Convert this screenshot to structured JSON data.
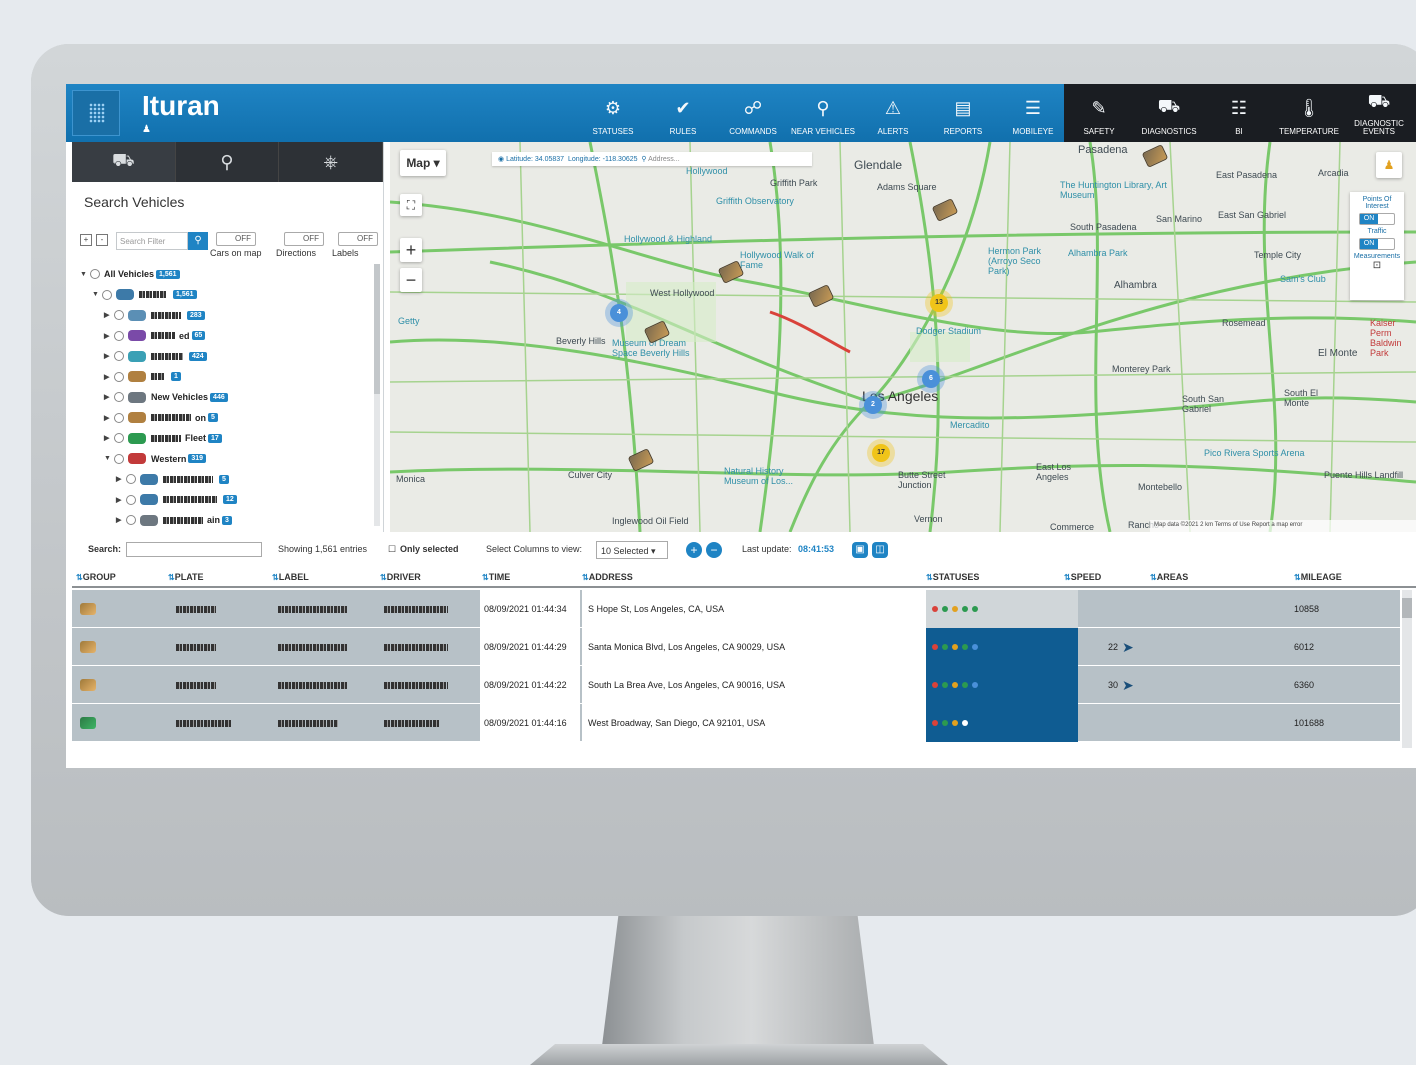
{
  "app": {
    "brand": "Ituran"
  },
  "nav": {
    "items": [
      {
        "label": "STATUSES",
        "icon": "statuses-icon"
      },
      {
        "label": "RULES",
        "icon": "rules-icon"
      },
      {
        "label": "COMMANDS",
        "icon": "commands-icon"
      },
      {
        "label": "NEAR VEHICLES",
        "icon": "near-vehicles-icon"
      },
      {
        "label": "ALERTS",
        "icon": "alerts-icon"
      },
      {
        "label": "REPORTS",
        "icon": "reports-icon"
      },
      {
        "label": "MOBILEYE",
        "icon": "mobileye-icon"
      }
    ],
    "right_items": [
      {
        "label": "SAFETY",
        "icon": "safety-icon"
      },
      {
        "label": "DIAGNOSTICS",
        "icon": "diagnostics-icon"
      },
      {
        "label": "BI",
        "icon": "bi-icon"
      },
      {
        "label": "TEMPERATURE",
        "icon": "temperature-icon"
      },
      {
        "label": "DIAGNOSTIC EVENTS",
        "icon": "diagnostic-events-icon"
      }
    ]
  },
  "left_panel": {
    "title": "Search Vehicles",
    "filter_placeholder": "Search Filter",
    "toggles": [
      {
        "state": "OFF",
        "label": "Cars on map"
      },
      {
        "state": "OFF",
        "label": "Directions"
      },
      {
        "state": "OFF",
        "label": "Labels"
      }
    ],
    "tree": [
      {
        "label": "All Vehicles",
        "count": "1,561",
        "level": 0
      },
      {
        "label": "",
        "count": "1,561",
        "level": 1
      },
      {
        "label": "",
        "count": "283",
        "level": 2
      },
      {
        "label": "ed",
        "count": "65",
        "level": 2
      },
      {
        "label": "",
        "count": "424",
        "level": 2
      },
      {
        "label": "",
        "count": "1",
        "level": 2
      },
      {
        "label": "New Vehicles",
        "count": "446",
        "level": 2
      },
      {
        "label": "on",
        "count": "5",
        "level": 2
      },
      {
        "label": "Fleet",
        "count": "17",
        "level": 2
      },
      {
        "label": "Western",
        "count": "319",
        "level": 2
      },
      {
        "label": "",
        "count": "5",
        "level": 3
      },
      {
        "label": "",
        "count": "12",
        "level": 3
      },
      {
        "label": "ain",
        "count": "3",
        "level": 3
      }
    ]
  },
  "map": {
    "type_button": "Map",
    "latitude_label": "Latitude:",
    "latitude": "34.05837",
    "longitude_label": "Longitude:",
    "longitude": "-118.30625",
    "address_placeholder": "Address...",
    "places": [
      "Glendale",
      "Adams Square",
      "Pasadena",
      "East Pasadena",
      "Arcadia",
      "The Huntington Library, Art Museum",
      "San Marino",
      "East San Gabriel",
      "Griffith Park",
      "Griffith Observatory",
      "Hollywood",
      "Hollywood & Highland",
      "Hollywood Walk of Fame",
      "West Hollywood",
      "Beverly Hills",
      "Museum of Dream Space Beverly Hills",
      "South Pasadena",
      "Alhambra Park",
      "Hermon Park (Arroyo Seco Park)",
      "Alhambra",
      "Temple City",
      "Sam's Club",
      "Dodger Stadium",
      "Rosemead",
      "El Monte",
      "Monterey Park",
      "South San Gabriel",
      "South El Monte",
      "Los Angeles",
      "Mercadito",
      "Pico Rivera Sports Arena",
      "East Los Angeles",
      "Montebello",
      "Puente Hills Landfill",
      "Culver City",
      "Natural History Museum of Los...",
      "Butte Street Junction",
      "Inglewood Oil Field",
      "Vernon",
      "Commerce",
      "Rancho",
      "Kaiser Perm Baldwin Park",
      "Monica",
      "Getty"
    ],
    "right_panel": {
      "poi_label": "Points Of Interest",
      "poi_state": "ON",
      "traffic_label": "Traffic",
      "traffic_state": "ON",
      "measurements_label": "Measurements"
    },
    "clusters": [
      {
        "label": "4",
        "color": "blue"
      },
      {
        "label": "13",
        "color": "yellow"
      },
      {
        "label": "6",
        "color": "blue"
      },
      {
        "label": "2",
        "color": "blue"
      },
      {
        "label": "17",
        "color": "yellow"
      }
    ],
    "footer": "Map data ©2021   2 km        Terms of Use   Report a map error"
  },
  "grid_bar": {
    "search_label": "Search:",
    "showing": "Showing 1,561 entries",
    "only_selected": "Only selected",
    "select_columns_label": "Select Columns to view:",
    "select_value": "10 Selected",
    "last_update_label": "Last update:",
    "last_update_time": "08:41:53"
  },
  "table": {
    "headers": [
      "GROUP",
      "PLATE",
      "LABEL",
      "DRIVER",
      "TIME",
      "ADDRESS",
      "STATUSES",
      "SPEED",
      "AREAS",
      "MILEAGE"
    ],
    "rows": [
      {
        "group": "truck",
        "time": "08/09/2021 01:44:34",
        "address": "S Hope St, Los Angeles, CA, USA",
        "speed": "",
        "mileage": "10858",
        "status_bg": "grey"
      },
      {
        "group": "truck",
        "time": "08/09/2021 01:44:29",
        "address": "Santa Monica Blvd, Los Angeles, CA 90029, USA",
        "speed": "22",
        "mileage": "6012",
        "status_bg": "blue"
      },
      {
        "group": "truck",
        "time": "08/09/2021 01:44:22",
        "address": "South La Brea Ave, Los Angeles, CA 90016, USA",
        "speed": "30",
        "mileage": "6360",
        "status_bg": "blue"
      },
      {
        "group": "car",
        "time": "08/09/2021 01:44:16",
        "address": "West Broadway, San Diego, CA 92101, USA",
        "speed": "",
        "mileage": "101688",
        "status_bg": "blue"
      }
    ]
  },
  "colors": {
    "accent": "#1f84c4",
    "topbar": "#1170ad",
    "dark": "#1a1d22"
  }
}
